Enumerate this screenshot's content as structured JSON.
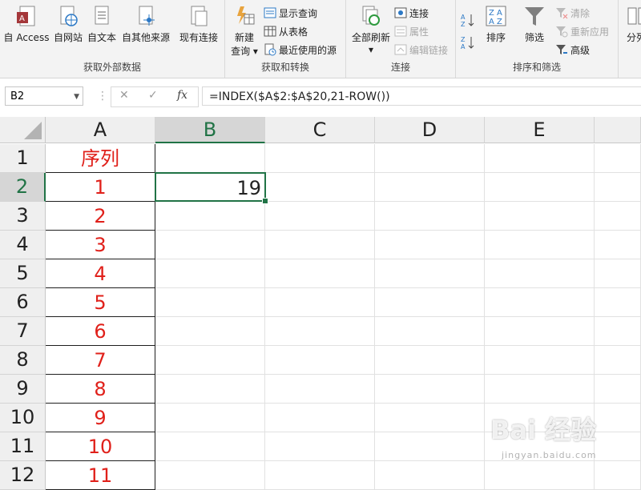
{
  "ribbon": {
    "get_external": {
      "label": "获取外部数据",
      "buttons": [
        "自 Access",
        "自网站",
        "自文本",
        "自其他来源",
        "现有连接"
      ]
    },
    "get_transform": {
      "label": "获取和转换",
      "new_query": "新建",
      "new_query_2": "查询",
      "show_query": "显示查询",
      "from_table": "从表格",
      "recent_sources": "最近使用的源"
    },
    "connections": {
      "label": "连接",
      "refresh_all": "全部刷新",
      "connections": "连接",
      "properties": "属性",
      "edit_links": "编辑链接"
    },
    "sort_filter": {
      "label": "排序和筛选",
      "sort": "排序",
      "filter": "筛选",
      "clear": "清除",
      "reapply": "重新应用",
      "advanced": "高级",
      "az": "A↓Z",
      "za": "Z↓A",
      "sort_icon_text_1": "Z A",
      "sort_icon_text_2": "A Z"
    },
    "more": "分列"
  },
  "formula_bar": {
    "name_box": "B2",
    "formula": "=INDEX($A$2:$A$20,21-ROW())",
    "cancel": "✕",
    "enter": "✓",
    "fx": "fx"
  },
  "columns": [
    "A",
    "B",
    "C",
    "D",
    "E"
  ],
  "rows": [
    "1",
    "2",
    "3",
    "4",
    "5",
    "6",
    "7",
    "8",
    "9",
    "10",
    "11",
    "12"
  ],
  "cells": {
    "A": [
      "序列",
      "1",
      "2",
      "3",
      "4",
      "5",
      "6",
      "7",
      "8",
      "9",
      "10",
      "11"
    ],
    "B2": "19"
  },
  "watermark": {
    "main": "Bai 经验",
    "sub": "jingyan.baidu.com"
  },
  "colors": {
    "accent": "#217346",
    "column_a_text": "#e0201a"
  }
}
